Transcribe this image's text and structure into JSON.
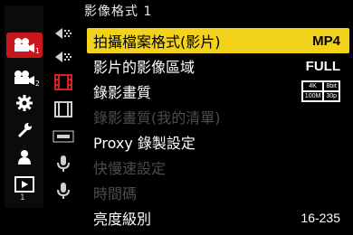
{
  "menu_title": "影像格式 1",
  "page_number": "1",
  "categories": [
    {
      "icon": "movie-camera-icon",
      "badge": "1",
      "active": true
    },
    {
      "icon": "movie-camera-icon",
      "badge": "2",
      "active": false
    },
    {
      "icon": "gear-icon",
      "active": false
    },
    {
      "icon": "wrench-icon",
      "active": false
    },
    {
      "icon": "person-icon",
      "active": false
    },
    {
      "icon": "playback-icon",
      "active": false
    }
  ],
  "sub_icons": [
    "arrow-left-icon",
    "arrow-left-icon",
    "film-strip-red-icon",
    "film-strip-icon",
    "focus-icon",
    "microphone-icon",
    "microphone-icon"
  ],
  "items": [
    {
      "label": "拍攝檔案格式(影片)",
      "value": "MP4",
      "selected": true
    },
    {
      "label": "影片的影像區域",
      "value": "FULL"
    },
    {
      "label": "錄影畫質",
      "badge": [
        "4K",
        "8bit",
        "100M",
        "30p"
      ]
    },
    {
      "label": "錄影畫質(我的清單)",
      "dim": true
    },
    {
      "label": "Proxy 錄製設定"
    },
    {
      "label": "快慢速設定",
      "dim": true
    },
    {
      "label": "時間碼",
      "dim": true
    },
    {
      "label": "亮度級別",
      "value": "16-235"
    }
  ],
  "colors": {
    "selected_bg": "#f2d21b",
    "active_tab": "#c8161d"
  }
}
